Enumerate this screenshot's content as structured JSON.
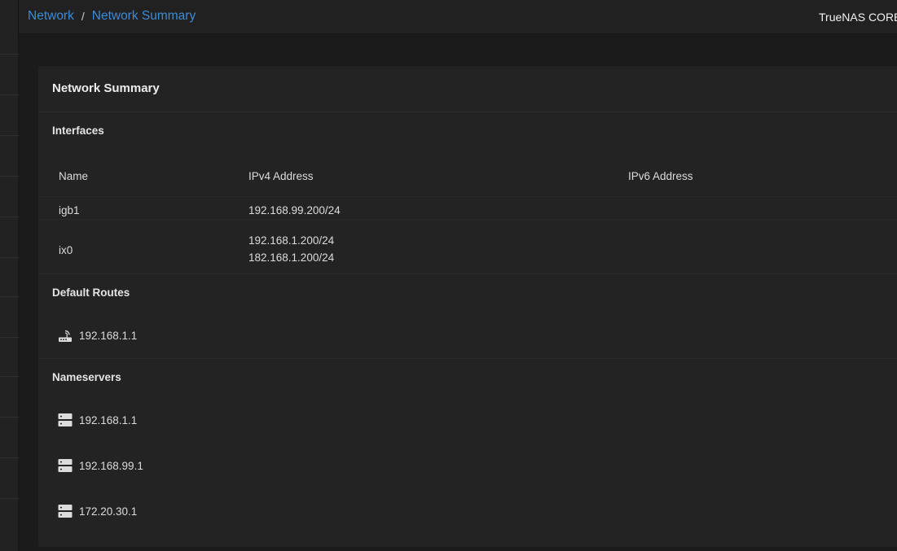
{
  "breadcrumb": {
    "parent": "Network",
    "separator": "/",
    "current": "Network Summary"
  },
  "brand": "TrueNAS CORE©",
  "card": {
    "title": "Network Summary",
    "interfaces": {
      "title": "Interfaces",
      "columns": [
        "Name",
        "IPv4 Address",
        "IPv6 Address"
      ],
      "rows": [
        {
          "name": "igb1",
          "ipv4": [
            "192.168.99.200/24"
          ],
          "ipv6": []
        },
        {
          "name": "ix0",
          "ipv4": [
            "192.168.1.200/24",
            "182.168.1.200/24"
          ],
          "ipv6": []
        }
      ]
    },
    "default_routes": {
      "title": "Default Routes",
      "icon": "router-icon",
      "items": [
        "192.168.1.1"
      ]
    },
    "nameservers": {
      "title": "Nameservers",
      "icon": "dns-server-icon",
      "items": [
        "192.168.1.1",
        "192.168.99.1",
        "172.20.30.1"
      ]
    }
  },
  "colors": {
    "background": "#1b1b1b",
    "card": "#232323",
    "link": "#3d8ad6",
    "text": "#e6e6e6"
  }
}
